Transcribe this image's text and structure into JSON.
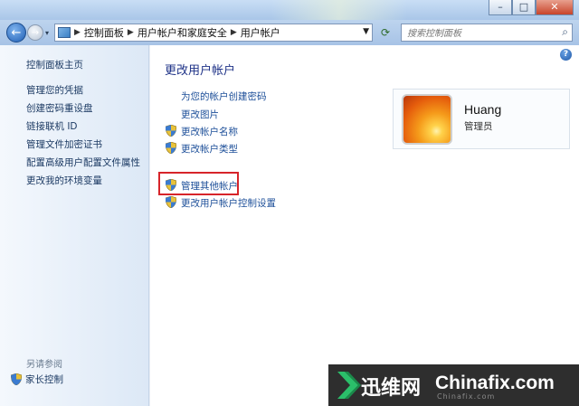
{
  "window": {
    "minimize": "–",
    "maximize": "□",
    "close": "✕"
  },
  "navbar": {
    "back": "←",
    "forward": "→",
    "breadcrumb": [
      "控制面板",
      "用户帐户和家庭安全",
      "用户帐户"
    ],
    "search_placeholder": "搜索控制面板"
  },
  "sidebar": {
    "items": [
      "控制面板主页",
      "管理您的凭据",
      "创建密码重设盘",
      "链接联机 ID",
      "管理文件加密证书",
      "配置高级用户配置文件属性",
      "更改我的环境变量"
    ],
    "see_also_label": "另请参阅",
    "see_also_items": [
      "家长控制"
    ]
  },
  "main": {
    "help": "?",
    "title": "更改用户帐户",
    "tasks": [
      "为您的帐户创建密码",
      "更改图片",
      "更改帐户名称",
      "更改帐户类型"
    ],
    "tasks2": [
      "管理其他帐户",
      "更改用户帐户控制设置"
    ]
  },
  "user": {
    "name": "Huang",
    "role": "管理员"
  },
  "watermark": {
    "cn": "迅维网",
    "en": "Chinafix.com",
    "sub": "Chinafix.com"
  }
}
